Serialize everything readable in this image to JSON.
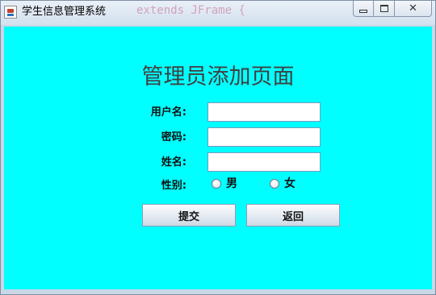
{
  "window": {
    "title": "学生信息管理系统",
    "background_text": "extends JFrame {",
    "controls": {
      "minimize": "minimize-icon",
      "maximize": "maximize-icon",
      "close": "close-icon"
    }
  },
  "form": {
    "title": "管理员添加页面",
    "background_color": "#00ffff",
    "fields": {
      "username_label": "用户名:",
      "username_value": "",
      "password_label": "密码:",
      "password_value": "",
      "name_label": "姓名:",
      "name_value": ""
    },
    "gender": {
      "label": "性别:",
      "options": [
        "男",
        "女"
      ]
    },
    "buttons": {
      "submit": "提交",
      "back": "返回"
    }
  }
}
